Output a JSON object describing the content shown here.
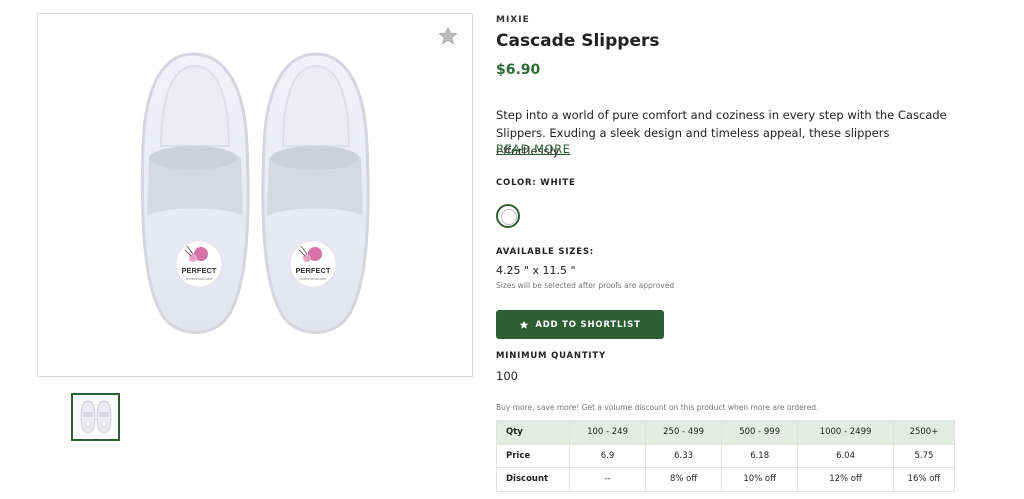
{
  "product": {
    "brand": "MIXIE",
    "name": "Cascade Slippers",
    "price": "$6.90",
    "description": "Step into a world of pure comfort and coziness in every step with the Cascade Slippers. Exuding a sleek design and timeless appeal, these slippers effortlessly…",
    "read_more_label": "READ MORE",
    "logo_text": "PERFECT",
    "logo_subtext": "professional care"
  },
  "color": {
    "label": "COLOR: WHITE",
    "swatch_hex": "#ffffff"
  },
  "sizes": {
    "label": "AVAILABLE SIZES:",
    "value": "4.25 \" x 11.5 \"",
    "note": "Sizes will be selected after proofs are approved"
  },
  "shortlist": {
    "label": "ADD TO SHORTLIST",
    "icon": "star-icon"
  },
  "minimum_quantity": {
    "label": "MINIMUM QUANTITY",
    "value": "100"
  },
  "volume": {
    "note": "Buy more, save more! Get a volume discount on this product when more are ordered.",
    "headers": [
      "Qty",
      "100 - 249",
      "250 - 499",
      "500 - 999",
      "1000 - 2499",
      "2500+"
    ],
    "price_row": [
      "Price",
      "6.9",
      "6.33",
      "6.18",
      "6.04",
      "5.75"
    ],
    "discount_row": [
      "Discount",
      "--",
      "8% off",
      "10% off",
      "12% off",
      "16% off"
    ]
  },
  "colors": {
    "accent": "#2e5e34",
    "price": "#2e6b34",
    "table_header": "#e4ebe5"
  }
}
